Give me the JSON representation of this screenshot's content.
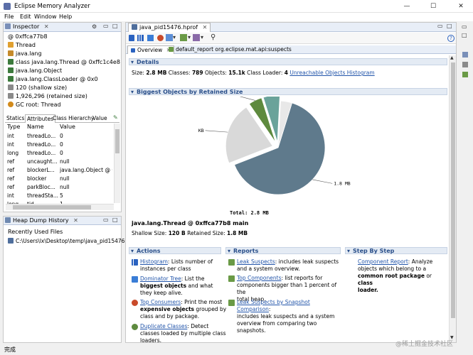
{
  "window": {
    "title": "Eclipse Memory Analyzer",
    "minimize": "—",
    "maximize": "☐",
    "close": "✕"
  },
  "menu": [
    "File",
    "Edit",
    "Window",
    "Help"
  ],
  "inspector": {
    "tab": "Inspector",
    "address": "@ 0xffca77b8",
    "items": [
      {
        "icon": "thread",
        "label": "Thread"
      },
      {
        "icon": "package",
        "label": "java.lang"
      },
      {
        "icon": "class",
        "label": "class java.lang.Thread @ 0xffc1c4e8"
      },
      {
        "icon": "class",
        "label": "java.lang.Object"
      },
      {
        "icon": "class",
        "label": "java.lang.ClassLoader @ 0x0"
      },
      {
        "icon": "size",
        "label": "120 (shallow size)"
      },
      {
        "icon": "size",
        "label": "1,926,296 (retained size)"
      },
      {
        "icon": "gc",
        "label": "GC root: Thread"
      }
    ],
    "subtabs": [
      "Statics",
      "Attributes",
      "Class Hierarchy",
      "Value"
    ],
    "columns": [
      "Type",
      "Name",
      "Value"
    ],
    "rows": [
      {
        "type": "int",
        "name": "threadLo...",
        "value": "0"
      },
      {
        "type": "int",
        "name": "threadLo...",
        "value": "0"
      },
      {
        "type": "long",
        "name": "threadLo...",
        "value": "0"
      },
      {
        "type": "ref",
        "name": "uncaught...",
        "value": "null"
      },
      {
        "type": "ref",
        "name": "blockerL...",
        "value": "java.lang.Object @ 0xf"
      },
      {
        "type": "ref",
        "name": "blocker",
        "value": "null"
      },
      {
        "type": "ref",
        "name": "parkBloc...",
        "value": "null"
      },
      {
        "type": "int",
        "name": "threadSta...",
        "value": "5"
      },
      {
        "type": "long",
        "name": "tid",
        "value": "1"
      }
    ]
  },
  "heap_history": {
    "tab": "Heap Dump History",
    "heading": "Recently Used Files",
    "file": "C:\\Users\\lx\\Desktop\\temp\\java_pid15476.hprof"
  },
  "editor": {
    "tab": "java_pid15476.hprof",
    "subtabs": [
      "Overview",
      "default_report  org.eclipse.mat.api:suspects"
    ],
    "details": {
      "header": "Details",
      "size_label": "Size:",
      "size": "2.8 MB",
      "classes_label": "Classes:",
      "classes": "789",
      "objects_label": "Objects:",
      "objects": "15.1k",
      "loader_label": "Class Loader:",
      "loader": "4",
      "link": "Unreachable Objects Histogram"
    },
    "biggest_header": "Biggest Objects by Retained Size",
    "selected": {
      "title": "java.lang.Thread @ 0xffca77b8 main",
      "shallow_label": "Shallow Size:",
      "shallow": "120 B",
      "retained_label": "Retained Size:",
      "retained": "1.8 MB"
    },
    "actions": {
      "header": "Actions",
      "items": [
        {
          "link": "Histogram",
          "text1": ": Lists number of",
          "text2": "instances per class",
          "text3": ""
        },
        {
          "link": "Dominator Tree",
          "text1": ": List the",
          "text2": "biggest objects",
          "text3": "and what they keep alive."
        },
        {
          "link": "Top Consumers",
          "text1": ": Print the most",
          "text2": "expensive objects",
          "text3": "grouped by class and by package."
        },
        {
          "link": "Duplicate Classes",
          "text1": ": Detect",
          "text2": "classes loaded by multiple class",
          "text3": "loaders."
        }
      ]
    },
    "reports": {
      "header": "Reports",
      "items": [
        {
          "link": "Leak Suspects",
          "text1": ": includes leak suspects",
          "text2": "and a system overview.",
          "text3": ""
        },
        {
          "link": "Top Components",
          "text1": ": list reports for",
          "text2": "components bigger than 1 percent of the",
          "text3": "total heap."
        },
        {
          "link": "Leak Suspects by Snapshot Comparison",
          "text1": ":",
          "text2": "includes leak suspects and a system",
          "text3": "overview from comparing two snapshots."
        }
      ]
    },
    "stepbystep": {
      "header": "Step By Step",
      "link": "Component Report",
      "text1": ": Analyze",
      "text2": "objects which belong to a",
      "bold1": "common root package",
      "text3": "or",
      "bold2": "class",
      "bold3": "loader."
    }
  },
  "chart_data": {
    "type": "pie",
    "unit": "MB",
    "slices": [
      {
        "label": "1.8 MB",
        "value": 1.8,
        "color": "#5f7a8c"
      },
      {
        "label": "615.8 KB",
        "value": 0.6,
        "color": "#d9d9d9"
      },
      {
        "label": "133.3 KB",
        "value": 0.13,
        "color": "#5e8a3e"
      },
      {
        "label": "161 KB",
        "value": 0.16,
        "color": "#6aa39a"
      },
      {
        "label": "",
        "value": 0.11,
        "color": "#e8e8e8"
      }
    ],
    "total_label": "Total: 2.8 MB"
  },
  "status": "完成",
  "watermark": "@稀土掘金技术社区"
}
